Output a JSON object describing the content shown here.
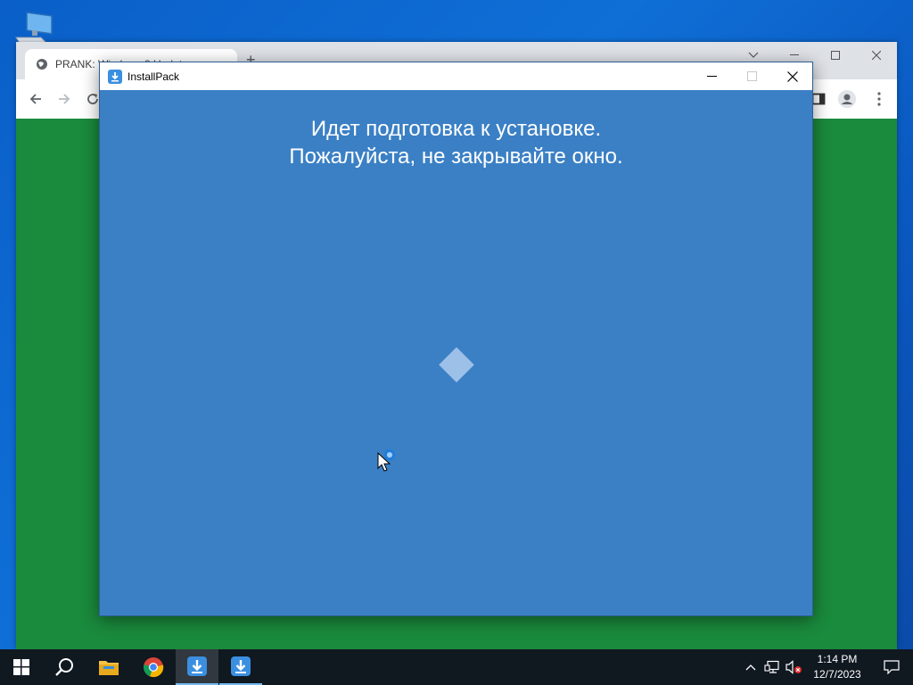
{
  "desktop": {
    "icon": "this-pc-icon"
  },
  "browser": {
    "tab_title": "PRANK: Windows 8 Update",
    "new_tab_symbol": "+",
    "content_color": "#1a8a3c"
  },
  "installer": {
    "title": "InstallPack",
    "message_line1": "Идет подготовка к установке.",
    "message_line2": "Пожалуйста, не закрывайте окно.",
    "background_color": "#3b80c5",
    "spinner_icon": "diamond-loader-icon"
  },
  "taskbar": {
    "items": [
      "start-icon",
      "search-icon",
      "file-explorer-icon",
      "chrome-icon",
      "installpack-icon",
      "installpack-icon"
    ],
    "clock_time": "1:14 PM",
    "clock_date": "12/7/2023"
  }
}
